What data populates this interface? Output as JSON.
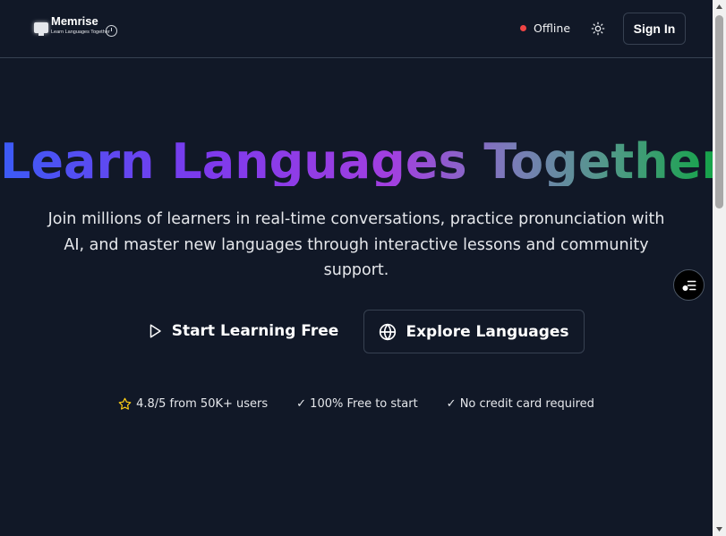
{
  "header": {
    "brand_title": "Memrise",
    "brand_subtitle": "Learn Languages Together",
    "status_label": "Offline",
    "signin_label": "Sign In"
  },
  "hero": {
    "title": "Learn Languages Together",
    "subtitle": "Join millions of learners in real-time conversations, practice pronunciation with AI, and master new languages through interactive lessons and community support.",
    "primary_cta": "Start Learning Free",
    "secondary_cta": "Explore Languages"
  },
  "trust": [
    {
      "text": "4.8/5 from 50K+ users",
      "icon": "star-icon"
    },
    {
      "text": "✓ 100% Free to start"
    },
    {
      "text": "✓ No credit card required"
    }
  ],
  "colors": {
    "background": "#111827",
    "status_dot": "#ef4444",
    "star": "#facc15",
    "gradient_start": "#3b5bf6",
    "gradient_mid": "#a23fe0",
    "gradient_end": "#16a34a"
  }
}
